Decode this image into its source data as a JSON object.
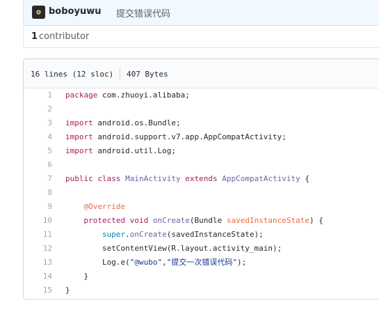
{
  "commit": {
    "author": "boboyuwu",
    "message": "提交错误代码"
  },
  "contributors": {
    "count": "1",
    "label": "contributor"
  },
  "file": {
    "lines_info": "16 lines (12 sloc)",
    "size": "407 Bytes"
  },
  "code_lines": [
    {
      "n": "1",
      "tokens": [
        {
          "t": "k",
          "v": "package"
        },
        {
          "t": "p",
          "v": " com.zhuoyi.alibaba;"
        }
      ]
    },
    {
      "n": "2",
      "tokens": []
    },
    {
      "n": "3",
      "tokens": [
        {
          "t": "k",
          "v": "import"
        },
        {
          "t": "p",
          "v": " android.os.Bundle;"
        }
      ]
    },
    {
      "n": "4",
      "tokens": [
        {
          "t": "k",
          "v": "import"
        },
        {
          "t": "p",
          "v": " android.support.v7.app.AppCompatActivity;"
        }
      ]
    },
    {
      "n": "5",
      "tokens": [
        {
          "t": "k",
          "v": "import"
        },
        {
          "t": "p",
          "v": " android.util.Log;"
        }
      ]
    },
    {
      "n": "6",
      "tokens": []
    },
    {
      "n": "7",
      "tokens": [
        {
          "t": "k",
          "v": "public"
        },
        {
          "t": "p",
          "v": " "
        },
        {
          "t": "k",
          "v": "class"
        },
        {
          "t": "p",
          "v": " "
        },
        {
          "t": "e",
          "v": "MainActivity"
        },
        {
          "t": "p",
          "v": " "
        },
        {
          "t": "k",
          "v": "extends"
        },
        {
          "t": "p",
          "v": " "
        },
        {
          "t": "e",
          "v": "AppCompatActivity"
        },
        {
          "t": "p",
          "v": " {"
        }
      ]
    },
    {
      "n": "8",
      "tokens": []
    },
    {
      "n": "9",
      "tokens": [
        {
          "t": "p",
          "v": "    "
        },
        {
          "t": "v",
          "v": "@Override"
        }
      ]
    },
    {
      "n": "10",
      "tokens": [
        {
          "t": "p",
          "v": "    "
        },
        {
          "t": "k",
          "v": "protected"
        },
        {
          "t": "p",
          "v": " "
        },
        {
          "t": "k",
          "v": "void"
        },
        {
          "t": "p",
          "v": " "
        },
        {
          "t": "e",
          "v": "onCreate"
        },
        {
          "t": "p",
          "v": "(Bundle "
        },
        {
          "t": "v",
          "v": "savedInstanceState"
        },
        {
          "t": "p",
          "v": ") {"
        }
      ]
    },
    {
      "n": "11",
      "tokens": [
        {
          "t": "p",
          "v": "        "
        },
        {
          "t": "c1",
          "v": "super"
        },
        {
          "t": "p",
          "v": "."
        },
        {
          "t": "e",
          "v": "onCreate"
        },
        {
          "t": "p",
          "v": "(savedInstanceState);"
        }
      ]
    },
    {
      "n": "12",
      "tokens": [
        {
          "t": "p",
          "v": "        setContentView(R.layout.activity_main);"
        }
      ]
    },
    {
      "n": "13",
      "tokens": [
        {
          "t": "p",
          "v": "        Log.e("
        },
        {
          "t": "s",
          "v": "\"@wubo\""
        },
        {
          "t": "p",
          "v": ","
        },
        {
          "t": "s",
          "v": "\"提交一次错误代码\""
        },
        {
          "t": "p",
          "v": ");"
        }
      ]
    },
    {
      "n": "14",
      "tokens": [
        {
          "t": "p",
          "v": "    }"
        }
      ]
    },
    {
      "n": "15",
      "tokens": [
        {
          "t": "p",
          "v": "}"
        }
      ]
    }
  ]
}
